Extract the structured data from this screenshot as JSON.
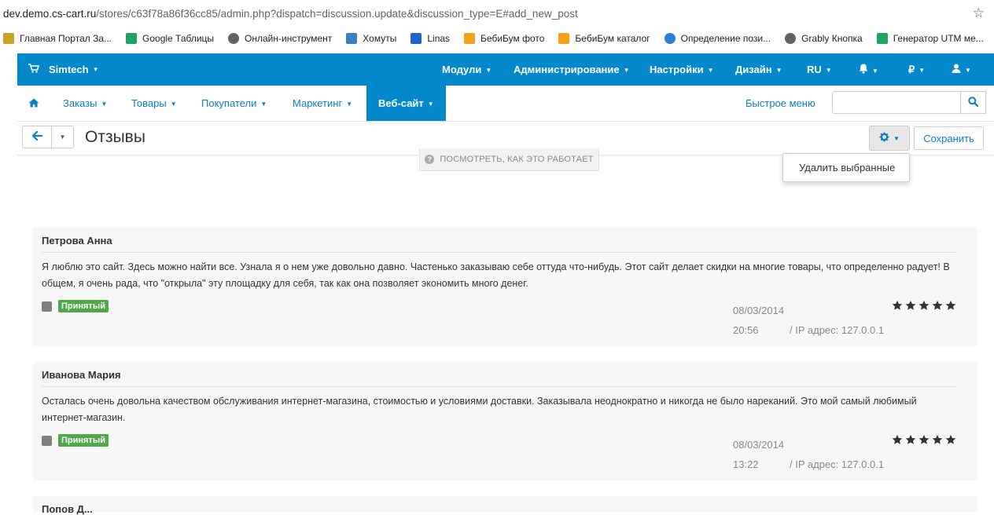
{
  "browser": {
    "url_host": "dev.demo.cs-cart.ru",
    "url_rest": "/stores/c63f78a86f36cc85/admin.php?dispatch=discussion.update&discussion_type=E#add_new_post",
    "bookmarks": [
      {
        "label": "Главная Портал За...",
        "icon": "emblem-icon",
        "color": "#c9a227"
      },
      {
        "label": "Google Таблицы",
        "icon": "sheets-icon",
        "color": "#1fa463"
      },
      {
        "label": "Онлайн-инструмент",
        "icon": "globe-icon",
        "color": "#5f6368"
      },
      {
        "label": "Хомуты",
        "icon": "gear-icon",
        "color": "#3c7dbf"
      },
      {
        "label": "Linas",
        "icon": "wave-icon",
        "color": "#1e63c5"
      },
      {
        "label": "БебиБум фото",
        "icon": "bebibum-icon",
        "color": "#f4a11c"
      },
      {
        "label": "БебиБум каталог",
        "icon": "bebibum-icon",
        "color": "#f4a11c"
      },
      {
        "label": "Определение пози...",
        "icon": "position-icon",
        "color": "#2a7fd4"
      },
      {
        "label": "Grably Кнопка",
        "icon": "globe-icon",
        "color": "#5f6368"
      },
      {
        "label": "Генератор UTM ме...",
        "icon": "utm-icon",
        "color": "#1fa463"
      }
    ]
  },
  "topnav": {
    "brand": "Simtech",
    "menu": [
      "Модули",
      "Администрирование",
      "Настройки",
      "Дизайн",
      "RU"
    ],
    "currency": "₽"
  },
  "subnav": {
    "items": [
      "Заказы",
      "Товары",
      "Покупатели",
      "Маркетинг",
      "Веб-сайт"
    ],
    "quick_menu": "Быстрое меню",
    "search_placeholder": ""
  },
  "page": {
    "title": "Отзывы",
    "save": "Сохранить",
    "how_it_works": "ПОСМОТРЕТЬ, КАК ЭТО РАБОТАЕТ",
    "dropdown_item": "Удалить выбранные"
  },
  "posts": [
    {
      "author": "Петрова Анна",
      "message": "Я люблю это сайт. Здесь можно найти все. Узнала я о нем уже довольно давно. Частенько заказываю себе оттуда что-нибудь. Этот сайт делает скидки на многие товары, что определенно радует! В общем, я очень рада, что \"открыла\" эту площадку для себя, так как она позволяет экономить много денег.",
      "status": "Принятый",
      "date": "08/03/2014",
      "time": "20:56",
      "ip": "/ IP адрес: 127.0.0.1",
      "rating": 5
    },
    {
      "author": "Иванова Мария",
      "message": "Осталась очень довольна качеством обслуживания интернет-магазина, стоимостью и условиями доставки. Заказывала неоднократно и никогда не было нареканий. Это мой самый любимый интернет-магазин.",
      "status": "Принятый",
      "date": "08/03/2014",
      "time": "13:22",
      "ip": "/ IP адрес: 127.0.0.1",
      "rating": 5
    },
    {
      "author": "Попов Д...",
      "message": "",
      "status": "",
      "date": "",
      "time": "",
      "ip": "",
      "rating": 0
    }
  ],
  "colors": {
    "primary": "#0388cc",
    "link": "#0b7fc4",
    "accepted": "#4fa948"
  }
}
